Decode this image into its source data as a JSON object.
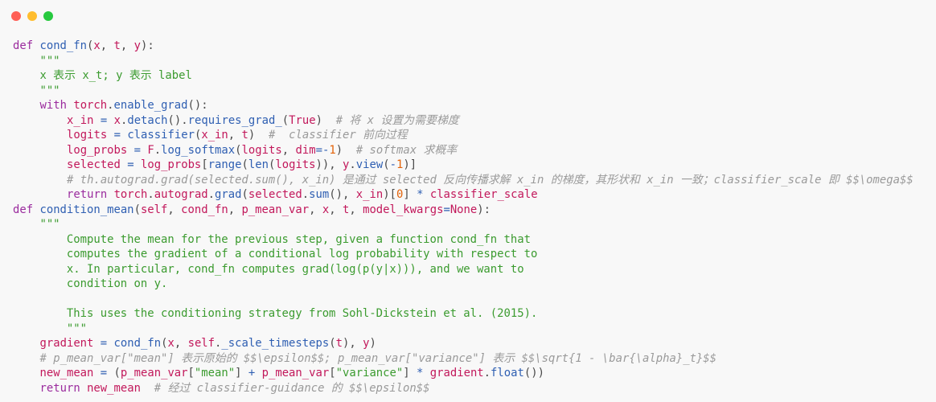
{
  "window": {
    "controls": [
      "close",
      "minimize",
      "maximize"
    ],
    "colors": {
      "close": "#ff5f56",
      "minimize": "#ffbd2e",
      "maximize": "#27c93f"
    }
  },
  "code": {
    "language": "python",
    "lines": [
      "def cond_fn(x, t, y):",
      "    \"\"\"",
      "    x 表示 x_t; y 表示 label",
      "    \"\"\"",
      "    with torch.enable_grad():",
      "        x_in = x.detach().requires_grad_(True)  # 将 x 设置为需要梯度",
      "        logits = classifier(x_in, t)  #  classifier 前向过程",
      "        log_probs = F.log_softmax(logits, dim=-1)  # softmax 求概率",
      "        selected = log_probs[range(len(logits)), y.view(-1)]",
      "        # th.autograd.grad(selected.sum(), x_in) 是通过 selected 反向传播求解 x_in 的梯度，其形状和 x_in 一致；classifier_scale 即 $$\\omega$$",
      "        return torch.autograd.grad(selected.sum(), x_in)[0] * classifier_scale",
      "def condition_mean(self, cond_fn, p_mean_var, x, t, model_kwargs=None):",
      "    \"\"\"",
      "        Compute the mean for the previous step, given a function cond_fn that",
      "        computes the gradient of a conditional log probability with respect to",
      "        x. In particular, cond_fn computes grad(log(p(y|x))), and we want to",
      "        condition on y.",
      "",
      "        This uses the conditioning strategy from Sohl-Dickstein et al. (2015).",
      "        \"\"\"",
      "    gradient = cond_fn(x, self._scale_timesteps(t), y)",
      "    # p_mean_var[\"mean\"] 表示原始的 $$\\epsilon$$; p_mean_var[\"variance\"] 表示 $$\\sqrt{1 - \\bar{\\alpha}_t}$$",
      "    new_mean = (p_mean_var[\"mean\"] + p_mean_var[\"variance\"] * gradient.float())",
      "    return new_mean  # 经过 classifier-guidance 的 $$\\epsilon$$"
    ]
  }
}
